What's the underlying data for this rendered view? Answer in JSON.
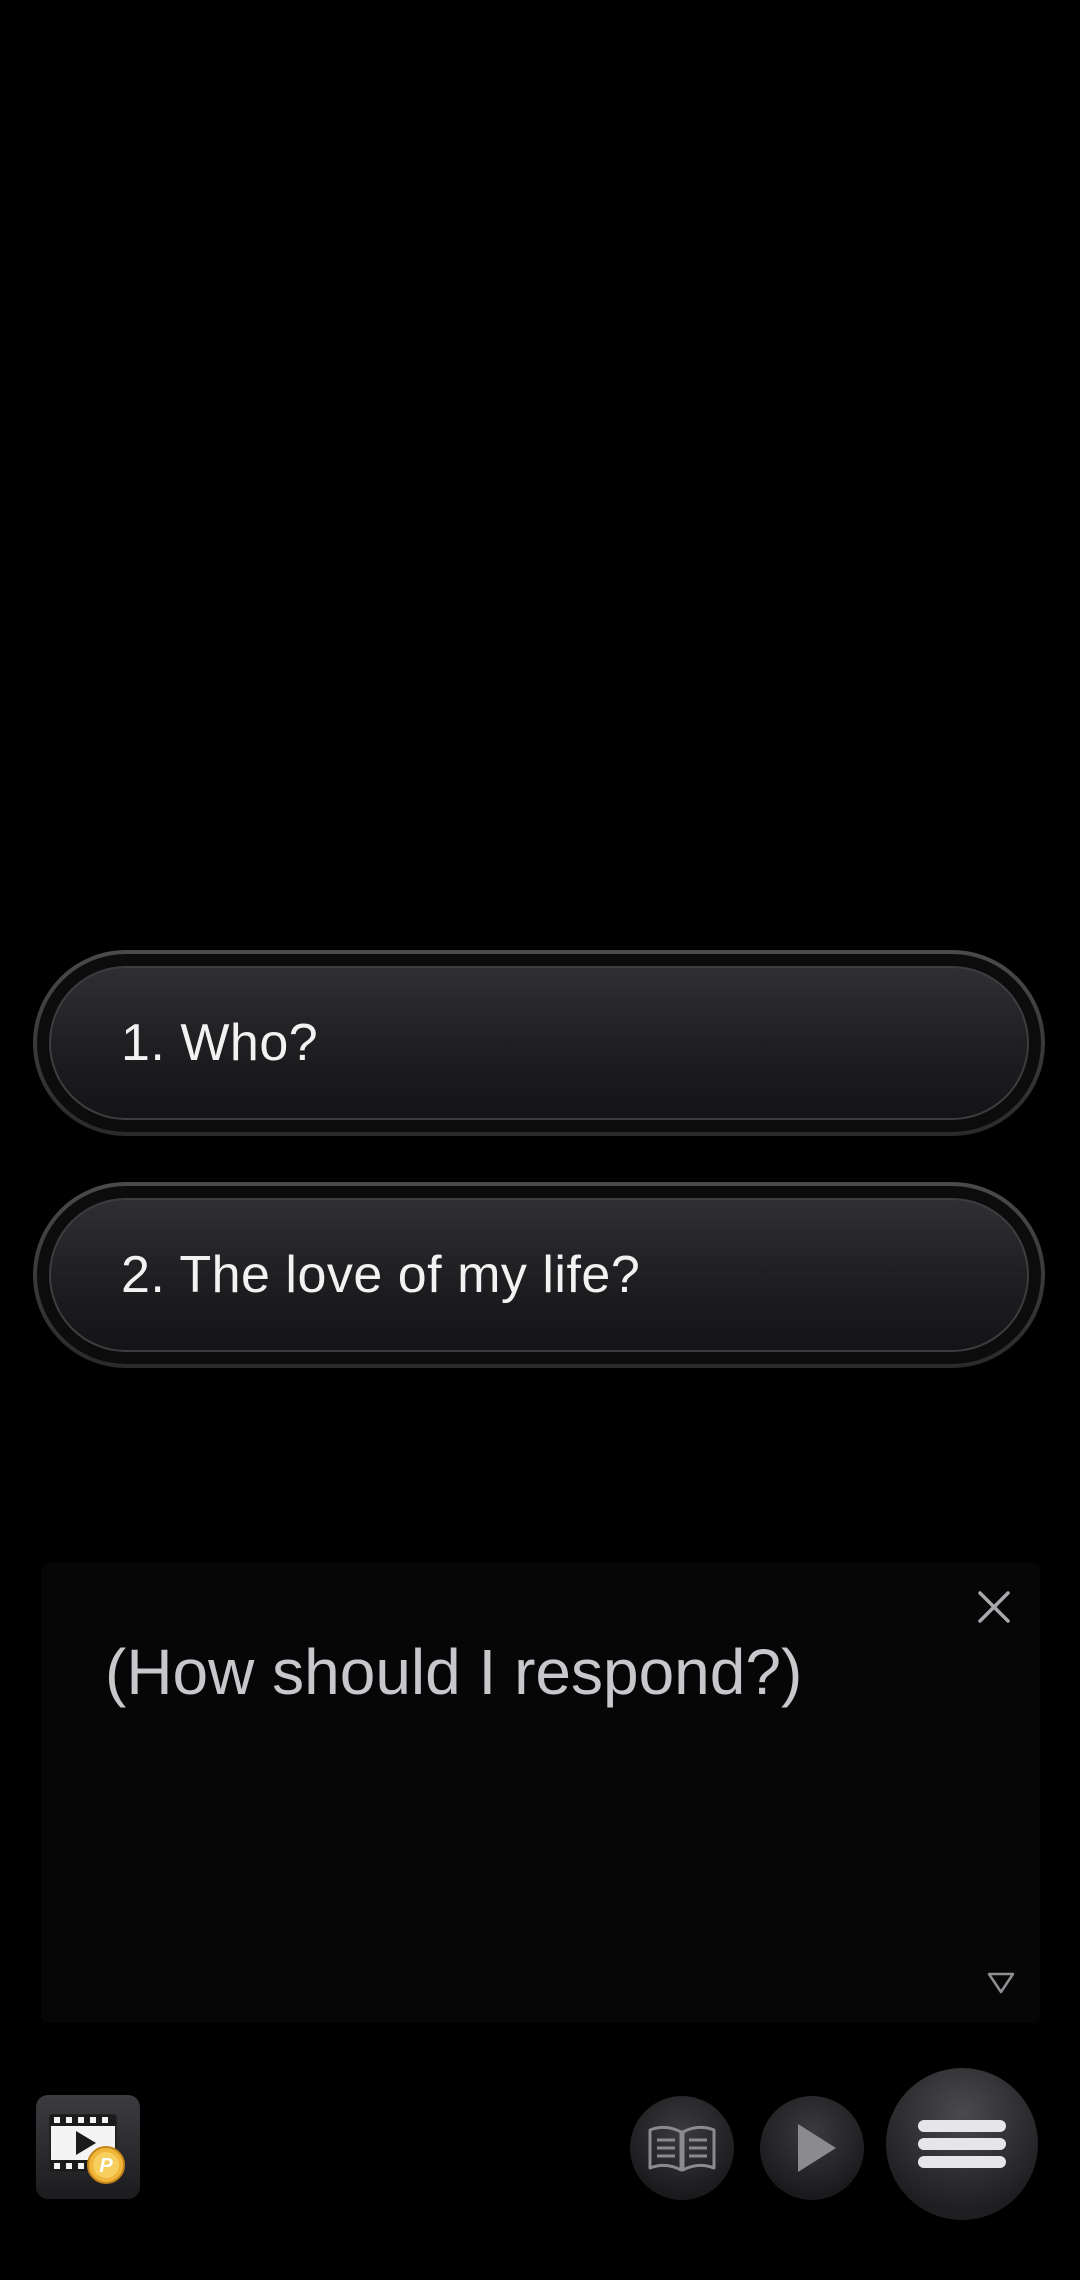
{
  "choices": [
    {
      "label": "1. Who?"
    },
    {
      "label": "2. The love of my life?"
    }
  ],
  "dialogue": {
    "text": "(How should I respond?)"
  },
  "icons": {
    "close": "close-icon",
    "advance": "triangle-down-icon",
    "movie": "movie-points-icon",
    "log": "book-icon",
    "auto": "play-icon",
    "menu": "hamburger-menu-icon"
  },
  "colors": {
    "background": "#000000",
    "choice_text": "#f2f2f2",
    "dialogue_text": "#c7c7cc",
    "coin": "#f0b63a"
  }
}
